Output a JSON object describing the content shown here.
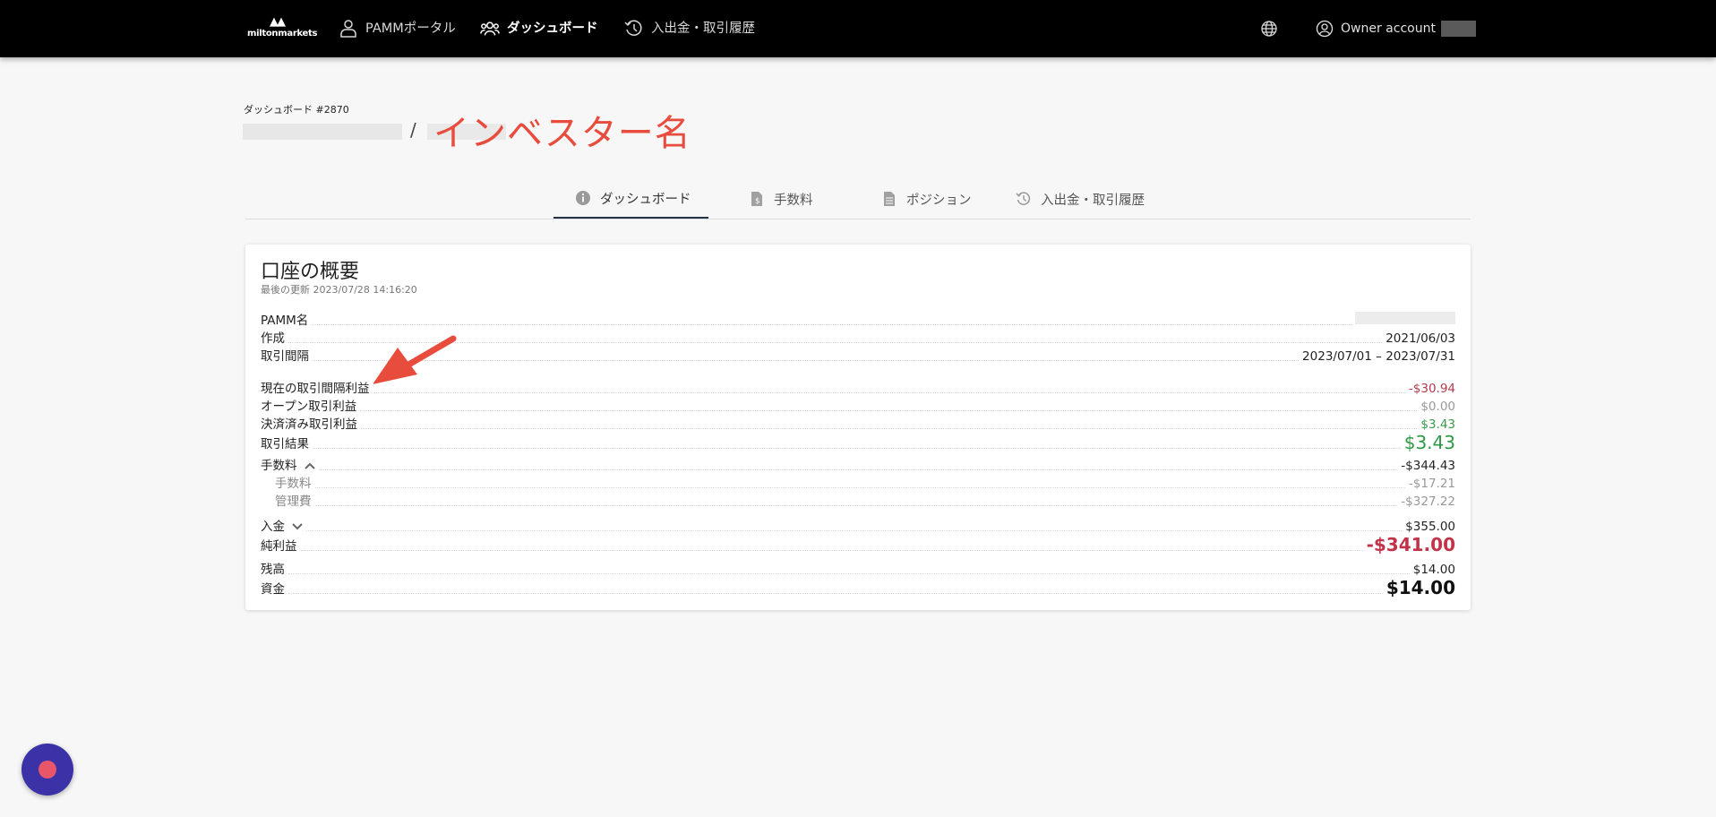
{
  "nav": {
    "logo_mark": "▲▲",
    "logo_word": "miltonmarkets",
    "pamm_portal": "PAMMポータル",
    "dashboard": "ダッシュボード",
    "history": "入出金・取引履歴",
    "owner_label": "Owner account"
  },
  "header": {
    "dashboard_id": "ダッシュボード #2870",
    "separator": "/",
    "investor_name_annotation": "インベスター名"
  },
  "tabs": [
    {
      "label": "ダッシュボード",
      "icon": "info-icon",
      "active": true
    },
    {
      "label": "手数料",
      "icon": "fee-document-icon",
      "active": false
    },
    {
      "label": "ポジション",
      "icon": "document-icon",
      "active": false
    },
    {
      "label": "入出金・取引履歴",
      "icon": "history-icon",
      "active": false
    }
  ],
  "summary": {
    "title": "口座の概要",
    "updated": "最後の更新 2023/07/28 14:16:20",
    "rows": {
      "pamm_name": {
        "label": "PAMM名",
        "value": ""
      },
      "created": {
        "label": "作成",
        "value": "2021/06/03"
      },
      "interval": {
        "label": "取引間隔",
        "value": "2023/07/01 – 2023/07/31"
      },
      "current_profit": {
        "label": "現在の取引間隔利益",
        "value": "-$30.94"
      },
      "open_profit": {
        "label": "オープン取引利益",
        "value": "$0.00"
      },
      "closed_profit": {
        "label": "決済済み取引利益",
        "value": "$3.43"
      },
      "result": {
        "label": "取引結果",
        "value": "$3.43"
      },
      "fees": {
        "label": "手数料",
        "value": "-$344.43"
      },
      "fee_sub": {
        "label": "手数料",
        "value": "-$17.21"
      },
      "management_fee": {
        "label": "管理費",
        "value": "-$327.22"
      },
      "deposit": {
        "label": "入金",
        "value": "$355.00"
      },
      "net_profit": {
        "label": "純利益",
        "value": "-$341.00"
      },
      "balance": {
        "label": "残高",
        "value": "$14.00"
      },
      "funds": {
        "label": "資金",
        "value": "$14.00"
      }
    }
  },
  "colors": {
    "annotation_red": "#e84c3d",
    "negative": "#b23a4a",
    "positive": "#3a9a4a",
    "tab_indicator": "#253344",
    "chat_bubble": "#3c32a8"
  }
}
